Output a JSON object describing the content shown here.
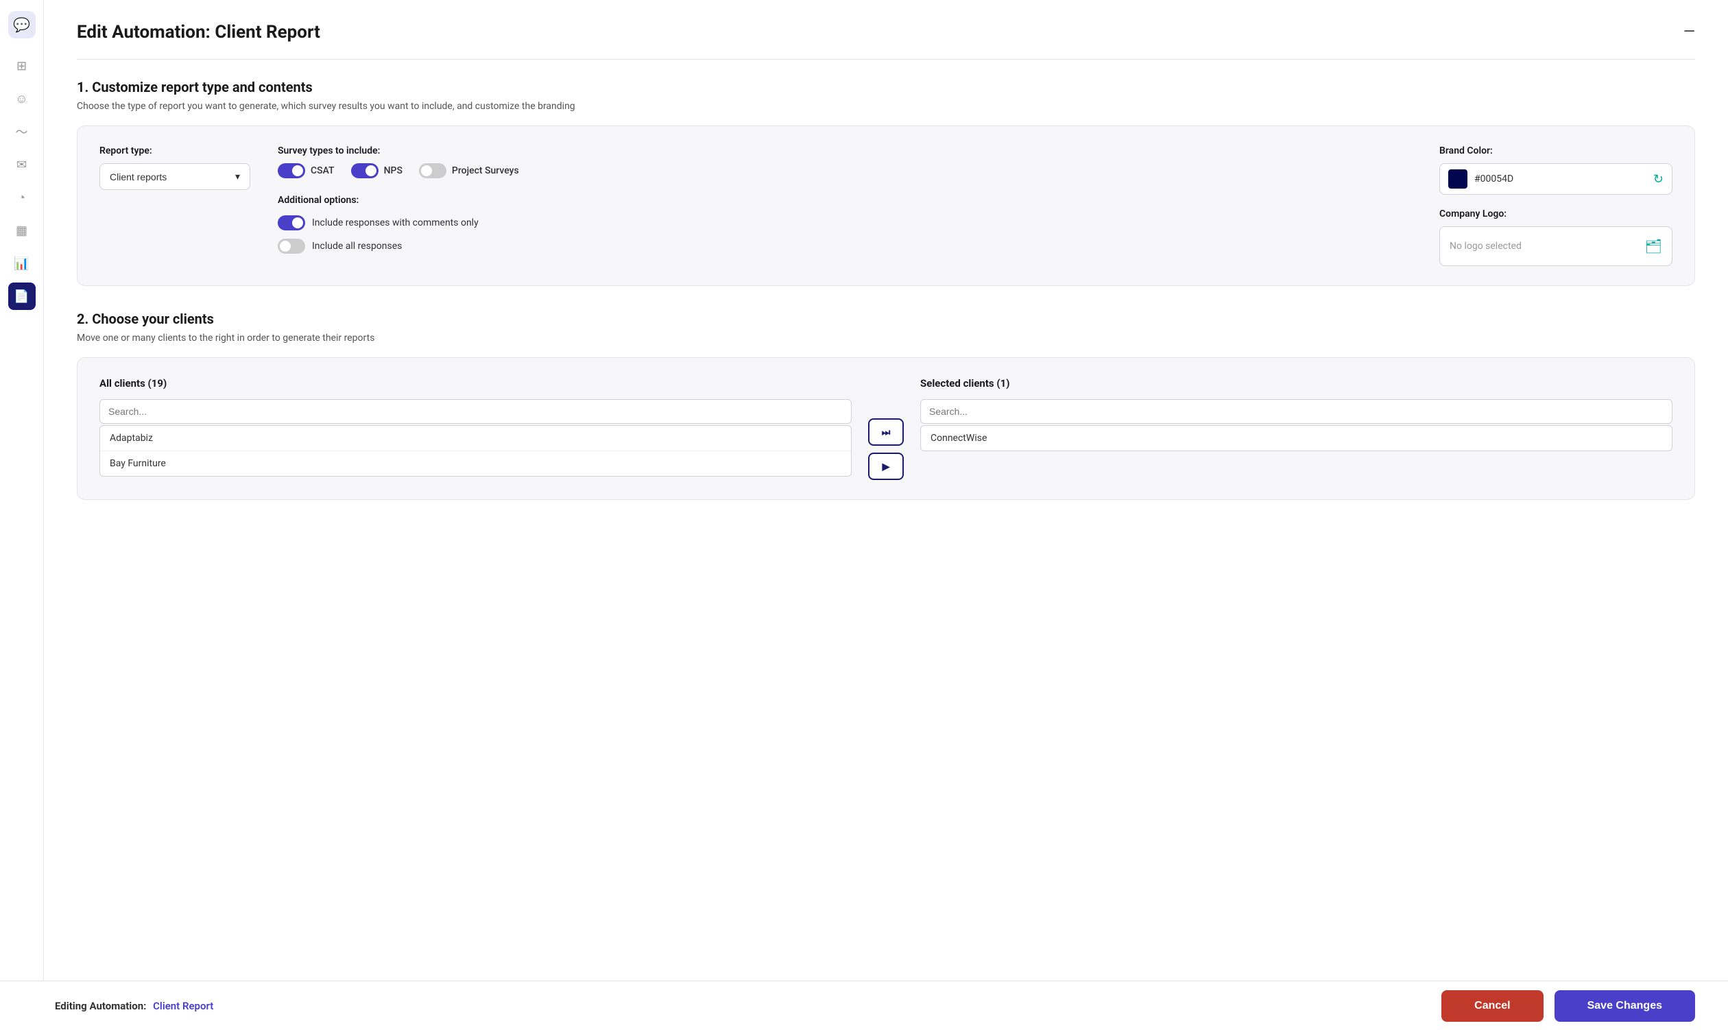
{
  "page": {
    "title": "Edit Automation: Client Report",
    "minimize_label": "—"
  },
  "section1": {
    "title": "1. Customize report type and contents",
    "description": "Choose the type of report you want to generate, which survey results you want to include, and customize the branding"
  },
  "report_type": {
    "label": "Report type:",
    "value": "Client reports"
  },
  "survey_types": {
    "label": "Survey types to include:",
    "items": [
      {
        "name": "CSAT",
        "on": true
      },
      {
        "name": "NPS",
        "on": true
      },
      {
        "name": "Project Surveys",
        "on": false
      }
    ]
  },
  "additional_options": {
    "label": "Additional options:",
    "items": [
      {
        "label": "Include responses with comments only",
        "on": true
      },
      {
        "label": "Include all responses",
        "on": false
      }
    ]
  },
  "brand_color": {
    "label": "Brand Color:",
    "value": "#00054D",
    "color_hex": "#00054D"
  },
  "company_logo": {
    "label": "Company Logo:",
    "placeholder": "No logo selected"
  },
  "section2": {
    "title": "2. Choose your clients",
    "description": "Move one or many clients to the right in order to generate their reports"
  },
  "all_clients": {
    "title": "All clients",
    "count": "(19)",
    "search_placeholder": "Search...",
    "items": [
      "Adaptabiz",
      "Bay Furniture"
    ]
  },
  "selected_clients": {
    "title": "Selected clients",
    "count": "(1)",
    "search_placeholder": "Search...",
    "items": [
      "ConnectWise"
    ]
  },
  "transfer_buttons": {
    "move_all": "⏭",
    "move_one": "▶"
  },
  "footer": {
    "editing_prefix": "Editing Automation:",
    "automation_name": "Client Report",
    "cancel_label": "Cancel",
    "save_label": "Save Changes"
  },
  "sidebar": {
    "logo_icon": "💬",
    "items": [
      {
        "icon": "⊞",
        "name": "dashboard",
        "active": false
      },
      {
        "icon": "☺",
        "name": "feedback",
        "active": false
      },
      {
        "icon": "∿",
        "name": "analytics",
        "active": false
      },
      {
        "icon": "✉",
        "name": "messages",
        "active": false
      },
      {
        "icon": "⏱",
        "name": "automation-time",
        "active": false
      },
      {
        "icon": "▦",
        "name": "reports-grid",
        "active": false
      },
      {
        "icon": "📊",
        "name": "charts",
        "active": false
      },
      {
        "icon": "📄",
        "name": "documents",
        "active": true
      }
    ]
  }
}
